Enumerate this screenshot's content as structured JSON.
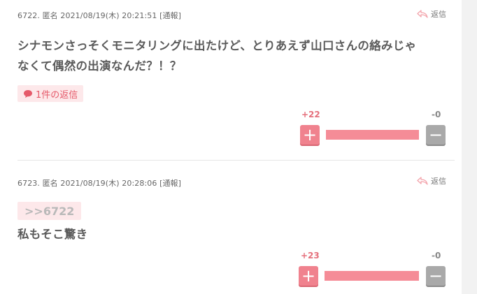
{
  "comments": [
    {
      "meta": "6722. 匿名 2021/08/19(木) 20:21:51 [通報]",
      "reply_label": "返信",
      "body_lines": [
        "シナモンさっそくモニタリングに出たけど、とりあえず山口さんの絡みじゃ",
        "なくて偶然の出演なんだ？！？"
      ],
      "replies_badge": "1件の返信",
      "plus_count": "+22",
      "minus_count": "-0",
      "plus_ratio": 1.0
    },
    {
      "meta": "6723. 匿名 2021/08/19(木) 20:28:06 [通報]",
      "reply_label": "返信",
      "anchor": ">>6722",
      "body_lines": [
        "私もそこ驚き"
      ],
      "plus_count": "+23",
      "minus_count": "-0",
      "plus_ratio": 1.0
    }
  ],
  "colors": {
    "accent_pink": "#f0828e",
    "badge_bg": "#fde8ea",
    "minus_gray": "#a9a9a9"
  }
}
